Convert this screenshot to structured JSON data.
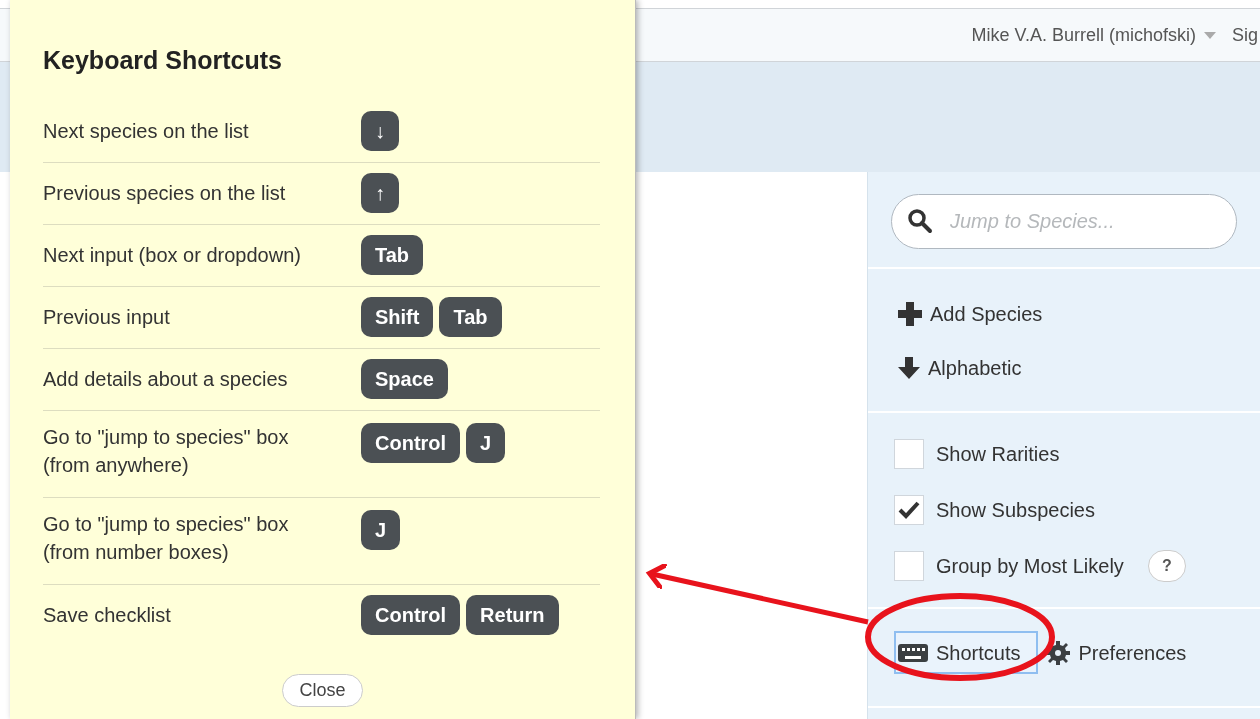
{
  "top_bar": {
    "user": "Mike V.A. Burrell (michofski)",
    "sign_link": "Sig"
  },
  "shortcuts_dialog": {
    "title": "Keyboard Shortcuts",
    "rows": [
      {
        "label": "Next species on the list",
        "keys": [
          "↓"
        ]
      },
      {
        "label": "Previous species on the list",
        "keys": [
          "↑"
        ]
      },
      {
        "label": "Next input (box or dropdown)",
        "keys": [
          "Tab"
        ]
      },
      {
        "label": "Previous input",
        "keys": [
          "Shift",
          "Tab"
        ]
      },
      {
        "label": "Add details about a species",
        "keys": [
          "Space"
        ]
      },
      {
        "label": "Go to \"jump to species\" box\n(from anywhere)",
        "keys": [
          "Control",
          "J"
        ]
      },
      {
        "label": "Go to \"jump to species\" box\n(from number boxes)",
        "keys": [
          "J"
        ]
      },
      {
        "label": "Save checklist",
        "keys": [
          "Control",
          "Return"
        ]
      }
    ],
    "close_button": "Close"
  },
  "sidebar": {
    "search": {
      "placeholder": "Jump to Species..."
    },
    "actions": [
      {
        "kind": "add",
        "label": "Add Species"
      },
      {
        "kind": "sort",
        "label": "Alphabetic"
      }
    ],
    "options": [
      {
        "label": "Show Rarities",
        "checked": false
      },
      {
        "label": "Show Subspecies",
        "checked": true
      },
      {
        "label": "Group by Most Likely",
        "checked": false,
        "help": "?"
      }
    ],
    "footer": [
      {
        "kind": "keyboard",
        "label": "Shortcuts",
        "selected": true
      },
      {
        "kind": "gear",
        "label": "Preferences",
        "selected": false
      }
    ]
  }
}
